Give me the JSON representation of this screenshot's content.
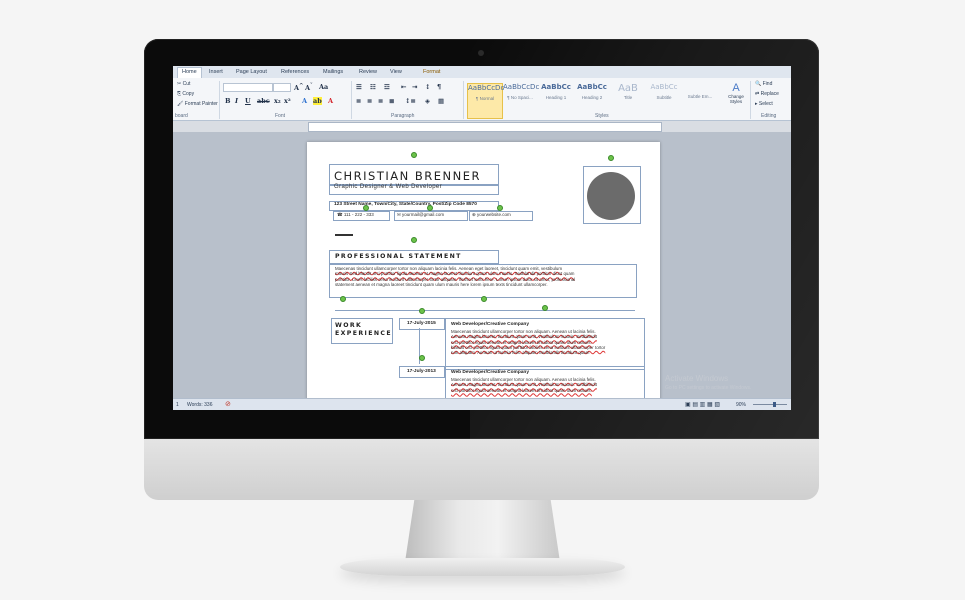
{
  "ribbon": {
    "tabs": [
      "Home",
      "Insert",
      "Page Layout",
      "References",
      "Mailings",
      "Review",
      "View",
      "Format"
    ],
    "clipboard": {
      "cut": "Cut",
      "copy": "Copy",
      "format_painter": "Format Painter",
      "group_label": "board"
    },
    "font": {
      "group_label": "Font"
    },
    "paragraph": {
      "group_label": "Paragraph"
    },
    "styles": {
      "group_label": "Styles",
      "items": [
        {
          "sample": "AaBbCcDc",
          "name": "¶ Normal"
        },
        {
          "sample": "AaBbCcDc",
          "name": "¶ No Spaci..."
        },
        {
          "sample": "AaBbCc",
          "name": "Heading 1"
        },
        {
          "sample": "AaBbCc",
          "name": "Heading 2"
        },
        {
          "sample": "AaB",
          "name": "Title"
        },
        {
          "sample": "AaBbCc",
          "name": "Subtitle"
        },
        {
          "sample": "",
          "name": "Subtle Em..."
        }
      ],
      "change_styles": "Change Styles"
    },
    "editing": {
      "group_label": "Editing",
      "find": "Find",
      "replace": "Replace",
      "select": "Select"
    }
  },
  "status_bar": {
    "page": "1",
    "words": "Words: 336",
    "zoom": "90%"
  },
  "watermark": {
    "line1": "Activate Windows",
    "line2": "Go to PC settings to activate Windows."
  },
  "resume": {
    "name": "CHRISTIAN BRENNER",
    "subtitle": "Graphic Designer & Web Developer",
    "address": "123 Street Name, Town/City, State/Country, Post/Zip Code 8570",
    "phone": "111 - 222 - 333",
    "email": "yourmail@gmail.com",
    "website": "yourwebsite.com",
    "statement_heading": "PROFESSIONAL STATEMENT",
    "statement_lines": [
      "Maecenas tincidunt ullamcorper tortor non aliquam lacinia felis. Aenean eget laoreet, tincidunt quam emit, vestibulum",
      "mauris Sed blandit orci porttitor ligula aenean et magna laoreet tincidunt quam ulum mauris. Sedblandit porttitor diunt quam",
      "porttitor. Lines faciliss cena incidunt ullamcorper tortor aliquam. Ifsshort texts here. Lorem ipsum dolor sit amet, professional",
      "statement aenean et magna laoreet tincidunt quam ulum mauris here lorem ipsum texts tincidunt ullamcorper."
    ],
    "work_heading_1": "WORK",
    "work_heading_2": "EXPERIENCE",
    "jobs": [
      {
        "date": "17-July-2015",
        "title": "Web Developer/Creative Company",
        "lines": [
          "Maecenas tincidunt ullamcorper tortor non aliquam. Aenean ut lacinia felis.",
          "Aenean magna laoreet, tincidunt quam emit, vestibulum mauris. Sedblandit",
          "orci porttitor ligula aenean et magna laoreet tincidunt quam ulum mauris.",
          "blandit orci porttitor ligula quam porttitor faciliss cena incidunt ullamcorper tortor",
          "non aliquam. Aenean ut lacinia felis. aliquam Sedblandit tincidunt quam"
        ]
      },
      {
        "date": "17-July-2013",
        "title": "Web Developer/Creative Company",
        "lines": [
          "Maecenas tincidunt ullamcorper tortor non aliquam. Aenean ut lacinia felis.",
          "Aenean magna laoreet, tincidunt quam emit, vestibulum mauris. Sedblandit",
          "orci porttitor ligula aenean et magna laoreet tincidunt quam ulum mauris."
        ]
      }
    ]
  },
  "colors": {
    "accent_green": "#6cc24a",
    "frame_blue": "#8aa2c2",
    "photo_gray": "#6b6b6b"
  }
}
